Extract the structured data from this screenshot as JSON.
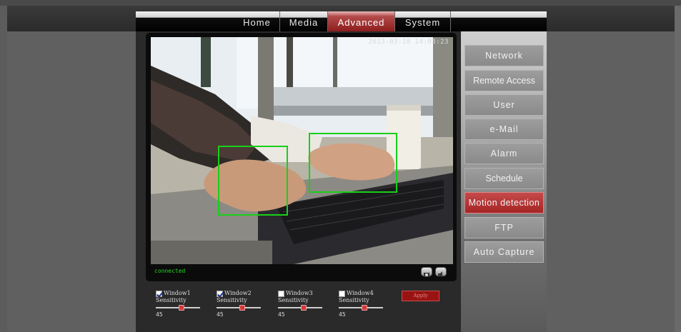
{
  "nav": {
    "tabs": [
      {
        "label": "Home",
        "active": false
      },
      {
        "label": "Media",
        "active": false
      },
      {
        "label": "Advanced",
        "active": true
      },
      {
        "label": "System",
        "active": false
      }
    ]
  },
  "video": {
    "timestamp": "2013-03-18 14:03:23",
    "status": "connected",
    "controls": [
      "snapshot-icon",
      "speaker-icon"
    ]
  },
  "motion": {
    "windows": [
      {
        "label": "Window1",
        "checked": true,
        "sensitivity_label": "Sensitivity",
        "value": "45"
      },
      {
        "label": "Window2",
        "checked": true,
        "sensitivity_label": "Sensitivity",
        "value": "45"
      },
      {
        "label": "Window3",
        "checked": false,
        "sensitivity_label": "Sensitivity",
        "value": "45"
      },
      {
        "label": "Window4",
        "checked": false,
        "sensitivity_label": "Sensitivity",
        "value": "45"
      }
    ],
    "apply_label": "Apply"
  },
  "sidebar": {
    "items": [
      {
        "label": "Network",
        "active": false
      },
      {
        "label": "Remote Access",
        "active": false
      },
      {
        "label": "User",
        "active": false
      },
      {
        "label": "e-Mail",
        "active": false
      },
      {
        "label": "Alarm",
        "active": false
      },
      {
        "label": "Schedule",
        "active": false
      },
      {
        "label": "Motion detection",
        "active": true
      },
      {
        "label": "FTP",
        "active": false
      },
      {
        "label": "Auto Capture",
        "active": false
      }
    ]
  },
  "colors": {
    "accent": "#a52424",
    "motion_box": "#18d018",
    "status_text": "#22d322"
  }
}
